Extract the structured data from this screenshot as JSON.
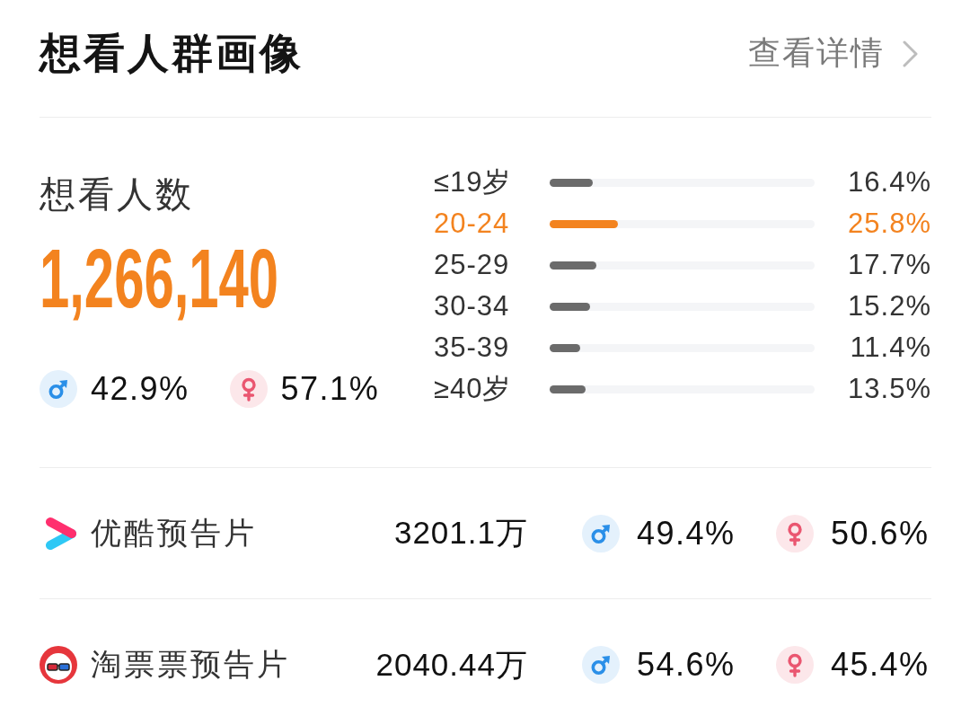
{
  "header": {
    "title": "想看人群画像",
    "link": {
      "label": "查看详情"
    }
  },
  "summary": {
    "label": "想看人数",
    "count": "1,266,140",
    "gender": [
      {
        "kind": "male",
        "share": "42.9%"
      },
      {
        "kind": "female",
        "share": "57.1%"
      }
    ]
  },
  "age_groups": [
    {
      "label": "≤19岁",
      "level": 0.164,
      "reading": "16.4%",
      "highlighted": false
    },
    {
      "label": "20-24",
      "level": 0.258,
      "reading": "25.8%",
      "highlighted": true
    },
    {
      "label": "25-29",
      "level": 0.177,
      "reading": "17.7%",
      "highlighted": false
    },
    {
      "label": "30-34",
      "level": 0.152,
      "reading": "15.2%",
      "highlighted": false
    },
    {
      "label": "35-39",
      "level": 0.114,
      "reading": "11.4%",
      "highlighted": false
    },
    {
      "label": "≥40岁",
      "level": 0.135,
      "reading": "13.5%",
      "highlighted": false
    }
  ],
  "platforms": [
    {
      "kind": "youku",
      "name": "优酷预告片",
      "count": "3201.1万",
      "gender": [
        {
          "kind": "male",
          "share": "49.4%"
        },
        {
          "kind": "female",
          "share": "50.6%"
        }
      ]
    },
    {
      "kind": "taopiaopiao",
      "name": "淘票票预告片",
      "count": "2040.44万",
      "gender": [
        {
          "kind": "male",
          "share": "54.6%"
        },
        {
          "kind": "female",
          "share": "45.4%"
        }
      ]
    }
  ]
}
